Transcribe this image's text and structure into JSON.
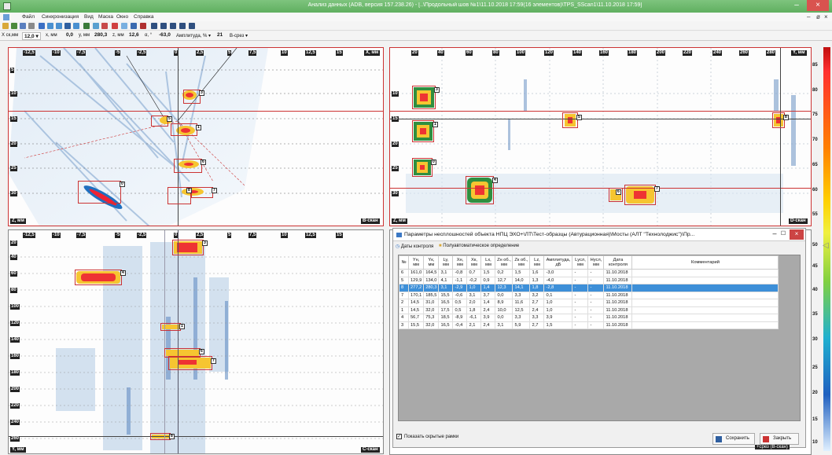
{
  "app": {
    "title": "Анализ данных (ADB, версия 157.238.26) - [..\\Продольный шов №1\\11.10.2018 17:59(16 элементов)\\TPS_SScan1\\11.10.2018 17:59]"
  },
  "window": {
    "minimize": "–",
    "restore": "ø",
    "close": "×"
  },
  "menu": {
    "items": [
      "Файл",
      "Синхронизация",
      "Вид",
      "Маска",
      "Окно",
      "Справка"
    ],
    "mdi_min": "–",
    "mdi_restore": "ø",
    "mdi_close": "×"
  },
  "toolbar": {
    "icons": [
      "open-icon",
      "data-icon",
      "filter-icon",
      "pencil-icon",
      "gain-icon",
      "zoom-icon",
      "zoom-out-icon",
      "save-icon",
      "zoom-fit-icon",
      "list-icon",
      "measure-icon",
      "marker-icon",
      "cursor-cross-icon",
      "lines-icon",
      "bars-icon",
      "crosshair-icon",
      "layout1-icon",
      "layout2-icon",
      "layout3-icon",
      "grid-icon",
      "settings-icon"
    ]
  },
  "params": [
    {
      "label": "X ск,мм",
      "value": "12,0 ▾"
    },
    {
      "label": "x, мм",
      "value": "0,0"
    },
    {
      "label": "y, мм",
      "value": "280,3"
    },
    {
      "label": "z, мм",
      "value": "12,6"
    },
    {
      "label": "α, °",
      "value": "-63,0"
    },
    {
      "label": "Амплитуда, % ▾",
      "value": "21"
    },
    {
      "label": "В-срез ▾",
      "value": ""
    }
  ],
  "views": {
    "tl": {
      "xticks": [
        "-12,5",
        "-10",
        "-7,5",
        "-5",
        "-2,5",
        "0",
        "2,5",
        "5",
        "7,5",
        "10",
        "12,5",
        "15"
      ],
      "xunit": "X, мм",
      "yticks": [
        "5",
        "10",
        "15",
        "20",
        "25",
        "30"
      ],
      "yunit": "Z, мм",
      "corner": "B-скан",
      "labels": [
        "3",
        "5",
        "1",
        "6",
        "0",
        "8",
        "7"
      ]
    },
    "tr": {
      "xticks": [
        "20",
        "40",
        "60",
        "80",
        "100",
        "120",
        "140",
        "160",
        "180",
        "200",
        "220",
        "240",
        "260",
        "280"
      ],
      "xunit": "Y, мм",
      "yticks": [
        "10",
        "15",
        "20",
        "25",
        "30"
      ],
      "yunit": "Z, мм",
      "corner": "D-скан",
      "labels": [
        "3",
        "1",
        "5",
        "0",
        "4",
        "6",
        "7",
        "8"
      ]
    },
    "bl": {
      "xticks": [
        "-12,5",
        "-10",
        "-7,5",
        "-5",
        "-2,5",
        "0",
        "2,5",
        "5",
        "7,5",
        "10",
        "12,5",
        "15"
      ],
      "yticks": [
        "20",
        "40",
        "60",
        "80",
        "100",
        "120",
        "140",
        "160",
        "180",
        "200",
        "220",
        "240",
        "260",
        "280"
      ],
      "yunit": "Y, мм",
      "corner": "С-скан",
      "labels": [
        "3",
        "4",
        "1",
        "6",
        "7",
        "8"
      ]
    }
  },
  "colorbar": {
    "ticks": [
      "85",
      "80",
      "75",
      "70",
      "65",
      "60",
      "55",
      "50",
      "45",
      "40",
      "35",
      "30",
      "25",
      "20",
      "15",
      "10"
    ],
    "colors": [
      "#c01010",
      "#ff8000",
      "#ffd000",
      "#80d040",
      "#20b0d0",
      "#2060c0"
    ]
  },
  "dialog": {
    "title": "Параметры несплошностей объекта НПЦ ЭХО+\\ЛТ\\Тест-образцы (Автурационная)\\Мосты (АЛТ \"Технолоджис\")\\Пр...",
    "min": "–",
    "max": "☐",
    "close": "×",
    "tabs": [
      "Даты контроля",
      "Полуавтоматическое определение"
    ],
    "columns": [
      "№",
      "Yн, мм",
      "Yк, мм",
      "Ly, мм",
      "Xн, мм",
      "Xк, мм",
      "Lx, мм",
      "Zн об., мм",
      "Zк об., мм",
      "Lz, мм",
      "Амплитуда, дБ",
      "Lусл, мм",
      "Нусл, мм",
      "Дата контроля",
      "Комментарий"
    ],
    "rows": [
      [
        "6",
        "161,0",
        "164,5",
        "3,1",
        "-0,8",
        "0,7",
        "1,5",
        "0,2",
        "1,5",
        "1,6",
        "-3,0",
        "-",
        "-",
        "11.10.2018",
        ""
      ],
      [
        "5",
        "129,9",
        "134,0",
        "4,1",
        "-1,1",
        "-0,2",
        "0,9",
        "12,7",
        "14,0",
        "1,3",
        "-4,0",
        "-",
        "-",
        "11.10.2018",
        ""
      ],
      [
        "8",
        "277,2",
        "280,3",
        "3,1",
        "-2,9",
        "1,0",
        "1,4",
        "12,3",
        "14,1",
        "1,8",
        "-2,8",
        "-",
        "-",
        "11.10.2018",
        ""
      ],
      [
        "7",
        "170,1",
        "185,5",
        "15,5",
        "-0,6",
        "3,1",
        "3,7",
        "0,0",
        "3,3",
        "3,2",
        "0,1",
        "-",
        "-",
        "11.10.2018",
        ""
      ],
      [
        "2",
        "14,5",
        "31,0",
        "16,5",
        "0,5",
        "2,0",
        "1,4",
        "8,9",
        "11,6",
        "2,7",
        "1,0",
        "-",
        "-",
        "11.10.2018",
        ""
      ],
      [
        "1",
        "14,5",
        "32,0",
        "17,5",
        "0,5",
        "1,8",
        "2,4",
        "10,0",
        "12,5",
        "2,4",
        "1,0",
        "-",
        "-",
        "11.10.2018",
        ""
      ],
      [
        "4",
        "56,7",
        "75,3",
        "18,5",
        "-8,9",
        "-6,1",
        "3,9",
        "0,0",
        "3,3",
        "3,3",
        "3,9",
        "-",
        "-",
        "11.10.2018",
        ""
      ],
      [
        "3",
        "15,5",
        "32,0",
        "16,5",
        "-0,4",
        "2,1",
        "2,4",
        "3,1",
        "5,9",
        "2,7",
        "1,5",
        "-",
        "-",
        "11.10.2018",
        ""
      ]
    ],
    "selected_row": 2,
    "show_hidden": "Показать скрытые рамки",
    "save": "Сохранить",
    "close_btn": "Закрыть"
  },
  "status": "+срез (B-скан)"
}
